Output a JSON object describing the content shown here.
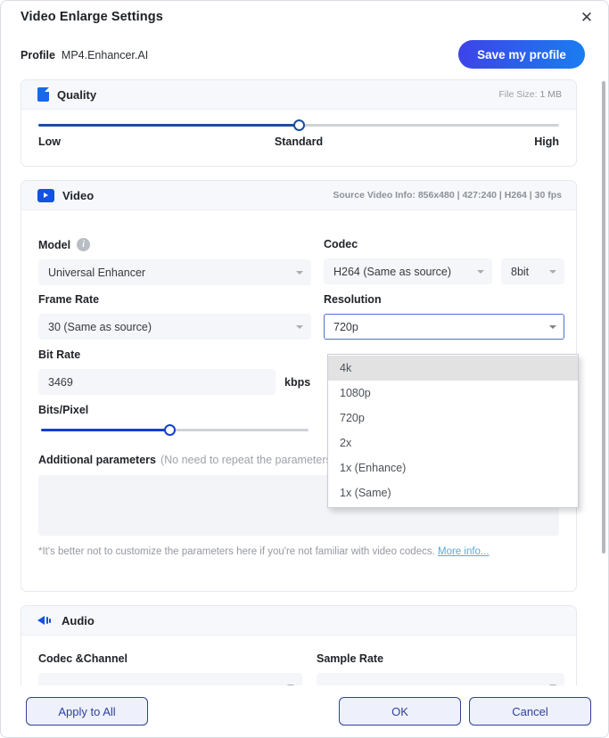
{
  "window": {
    "title": "Video Enlarge Settings",
    "close_icon": "close-icon"
  },
  "profile": {
    "label": "Profile",
    "value": "MP4.Enhancer.AI",
    "save_button": "Save my profile"
  },
  "quality": {
    "header": "Quality",
    "icon": "document-icon",
    "file_size_label": "File Size:",
    "file_size_value": "1 MB",
    "slider": {
      "low": "Low",
      "standard": "Standard",
      "high": "High",
      "percent": 50
    }
  },
  "video": {
    "header": "Video",
    "icon": "video-play-icon",
    "source_info": "Source Video Info: 856x480 | 427:240 | H264 | 30 fps",
    "model": {
      "label": "Model",
      "info_icon": "info-icon",
      "value": "Universal Enhancer"
    },
    "codec": {
      "label": "Codec",
      "value": "H264 (Same as source)",
      "depth_value": "8bit"
    },
    "frame_rate": {
      "label": "Frame Rate",
      "value": "30 (Same as source)"
    },
    "resolution": {
      "label": "Resolution",
      "value": "720p",
      "expanded": true,
      "options": [
        "4k",
        "1080p",
        "720p",
        "2x",
        "1x (Enhance)",
        "1x (Same)"
      ],
      "highlighted_option": "4k"
    },
    "bit_rate": {
      "label": "Bit Rate",
      "value": "3469",
      "unit": "kbps"
    },
    "bits_per_pixel": {
      "label": "Bits/Pixel",
      "percent": 48
    },
    "additional_parameters": {
      "label": "Additional parameters",
      "hint": "(No need to repeat the parameters above)",
      "value": ""
    },
    "footnote": {
      "text": "*It's better not to customize the parameters here if you're not familiar with video codecs. ",
      "link": "More info..."
    }
  },
  "audio": {
    "header": "Audio",
    "icon": "speaker-icon",
    "codec_channel_label": "Codec &Channel",
    "sample_rate_label": "Sample Rate"
  },
  "footer": {
    "apply_to_all": "Apply to All",
    "ok": "OK",
    "cancel": "Cancel"
  }
}
